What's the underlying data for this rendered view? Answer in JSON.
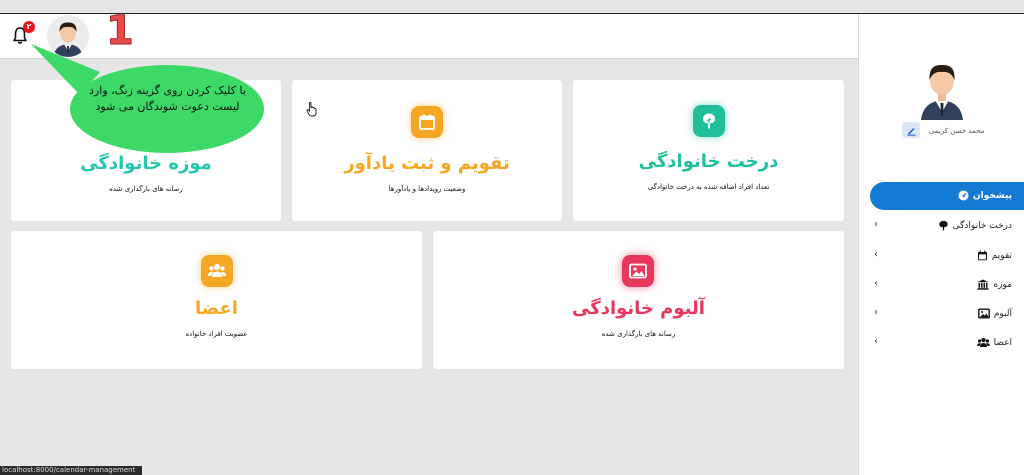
{
  "topbar": {
    "notification_count": "۲",
    "step_number": "1"
  },
  "tooltip": {
    "text": "با کلیک کردن روی گزینه زنگ، وارد لیست دعوت شوندگان می شود"
  },
  "cards": [
    {
      "id": "museum",
      "title": "موزه خانوادگی",
      "description": "رسانه های بارگذاری شده",
      "color": "#26c6b0",
      "icon": "museum-icon"
    },
    {
      "id": "calendar",
      "title": "تقویم و ثبت یادآور",
      "description": "وضعیت رویدادها و یادآورها",
      "color": "#f5a623",
      "icon": "calendar-icon"
    },
    {
      "id": "family-tree",
      "title": "درخت خانوادگی",
      "description": "تعداد افراد اضافه شده به درخت خانوادگی",
      "color": "#1fbf9a",
      "icon": "tree-icon"
    },
    {
      "id": "members",
      "title": "اعضا",
      "description": "عضویت افراد خانواده",
      "color": "#f5a623",
      "icon": "members-icon"
    },
    {
      "id": "album",
      "title": "آلبوم خانوادگی",
      "description": "رسانه های بارگذاری شده",
      "color": "#e8365d",
      "icon": "album-icon"
    }
  ],
  "sidebar": {
    "user_name": "محمد حسن کریمی",
    "items": [
      {
        "label": "پیشخوان",
        "icon": "dashboard-icon",
        "active": true
      },
      {
        "label": "درخت خانوادگی",
        "icon": "tree-icon",
        "chevron": "‹"
      },
      {
        "label": "تقویم",
        "icon": "calendar-icon",
        "chevron": "‹"
      },
      {
        "label": "موزه",
        "icon": "museum-icon",
        "chevron": "‹"
      },
      {
        "label": "آلبوم",
        "icon": "album-icon",
        "chevron": "‹"
      },
      {
        "label": "اعضا",
        "icon": "members-icon",
        "chevron": "‹"
      }
    ]
  },
  "status_bar": {
    "url": "localhost:8000/calendar-management"
  },
  "colors": {
    "accent": "#1479d3",
    "tooltip": "#3cd967",
    "step_number": "#e64a4a"
  }
}
